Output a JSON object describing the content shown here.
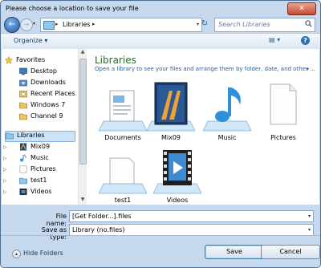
{
  "window": {
    "title": "Please choose a location to save your file",
    "close_glyph": "✕"
  },
  "nav": {
    "back_glyph": "←",
    "forward_glyph": "→",
    "history_glyph": "▾",
    "breadcrumb": [
      "Libraries"
    ],
    "breadcrumb_sep": "▸",
    "address_dropdown": "▾",
    "refresh_glyph": "↻",
    "search_placeholder": "Search Libraries",
    "search_icon": "search-icon"
  },
  "toolbar": {
    "organize_label": "Organize ▾",
    "view_glyph": "▤ ▾",
    "help_glyph": "?"
  },
  "sidebar": {
    "favorites_label": "Favorites",
    "favorites": [
      {
        "label": "Desktop",
        "icon": "desktop-icon"
      },
      {
        "label": "Downloads",
        "icon": "downloads-icon"
      },
      {
        "label": "Recent Places",
        "icon": "recent-places-icon"
      },
      {
        "label": "Windows 7",
        "icon": "folder-icon"
      },
      {
        "label": "Channel 9",
        "icon": "folder-icon"
      }
    ],
    "libraries_label": "Libraries",
    "libraries": [
      {
        "label": "Mix09",
        "icon": "mix-library-icon"
      },
      {
        "label": "Music",
        "icon": "music-icon"
      },
      {
        "label": "Pictures",
        "icon": "pictures-icon"
      },
      {
        "label": "test1",
        "icon": "library-icon"
      },
      {
        "label": "Videos",
        "icon": "videos-icon"
      }
    ]
  },
  "main": {
    "title": "Libraries",
    "subtitle": "Open a library to see your files and arrange them by folder, date, and other ...",
    "subtitle_dropdown": "▾",
    "tiles": [
      {
        "label": "Documents",
        "icon": "documents-library-icon"
      },
      {
        "label": "Mix09",
        "icon": "mix09-library-icon"
      },
      {
        "label": "Music",
        "icon": "music-library-icon"
      },
      {
        "label": "Pictures",
        "icon": "pictures-library-icon"
      },
      {
        "label": "test1",
        "icon": "generic-library-icon"
      },
      {
        "label": "Videos",
        "icon": "videos-library-icon"
      }
    ]
  },
  "form": {
    "file_name_label": "File name:",
    "file_name_value": "[Get Folder...].files",
    "save_type_label": "Save as type:",
    "save_type_value": "Library (no.files)"
  },
  "footer": {
    "hide_folders_label": "Hide Folders",
    "hide_glyph": "▴",
    "save_label": "Save",
    "cancel_label": "Cancel"
  },
  "colors": {
    "accent": "#2a6a2e",
    "link": "#2e5d97",
    "chrome": "#c6d9ee"
  }
}
